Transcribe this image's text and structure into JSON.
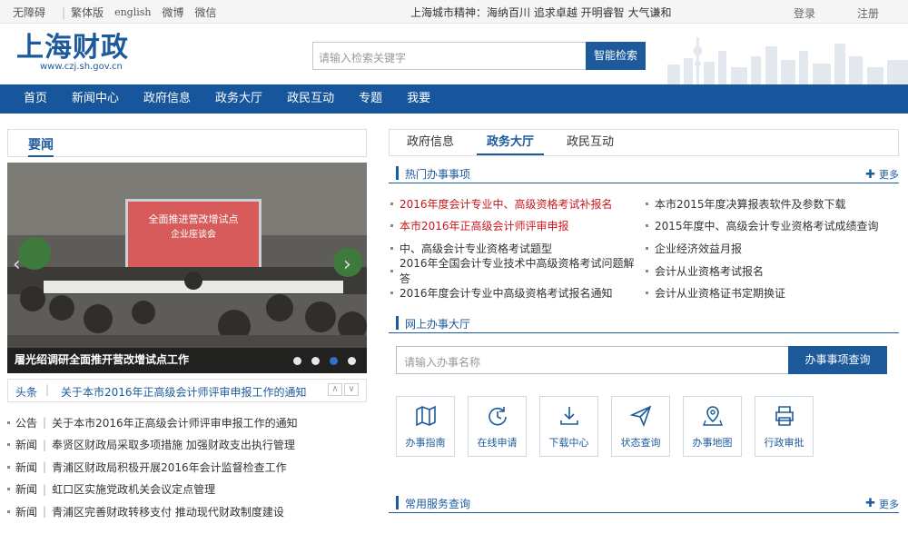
{
  "topbar": {
    "links": [
      "无障碍",
      "繁体版",
      "english",
      "微博",
      "微信"
    ],
    "spirit": "上海城市精神：海纳百川  追求卓越  开明睿智  大气谦和",
    "login": "登录",
    "register": "注册"
  },
  "header": {
    "logo_text": "上海财政",
    "logo_url": "www.czj.sh.gov.cn",
    "search_placeholder": "请输入检索关键字",
    "search_button": "智能检索"
  },
  "nav": [
    "首页",
    "新闻中心",
    "政府信息",
    "政务大厅",
    "政民互动",
    "专题",
    "我要"
  ],
  "left": {
    "tab": "要闻",
    "slide": {
      "banner_line1": "全面推进营改增试点",
      "banner_line2": "企业座谈会",
      "caption": "屠光绍调研全面推开营改增试点工作",
      "dots": 4,
      "active_dot": 3
    },
    "headline": {
      "tag": "头条",
      "text": "关于本市2016年正高级会计师评审申报工作的通知"
    },
    "news": [
      {
        "cat": "公告",
        "title": "关于本市2016年正高级会计师评审申报工作的通知"
      },
      {
        "cat": "新闻",
        "title": "奉贤区财政局采取多项措施 加强财政支出执行管理"
      },
      {
        "cat": "新闻",
        "title": "青浦区财政局积极开展2016年会计监督检查工作"
      },
      {
        "cat": "新闻",
        "title": "虹口区实施党政机关会议定点管理"
      },
      {
        "cat": "新闻",
        "title": "青浦区完善财政转移支付 推动现代财政制度建设"
      }
    ]
  },
  "right": {
    "tabs": [
      "政府信息",
      "政务大厅",
      "政民互动"
    ],
    "active_tab": 1,
    "hot": {
      "title": "热门办事事项",
      "more": "更多",
      "left_items": [
        {
          "text": "2016年度会计专业中、高级资格考试补报名",
          "red": true
        },
        {
          "text": "本市2016年正高级会计师评审申报",
          "red": true
        },
        {
          "text": "中、高级会计专业资格考试题型",
          "red": false
        },
        {
          "text": "2016年全国会计专业技术中高级资格考试问题解答",
          "red": false
        },
        {
          "text": "2016年度会计专业中高级资格考试报名通知",
          "red": false
        }
      ],
      "right_items": [
        "本市2015年度决算报表软件及参数下载",
        "2015年度中、高级会计专业资格考试成绩查询",
        "企业经济效益月报",
        "会计从业资格考试报名",
        "会计从业资格证书定期换证"
      ]
    },
    "online": {
      "title": "网上办事大厅",
      "placeholder": "请输入办事名称",
      "button": "办事事项查询",
      "tiles": [
        {
          "label": "办事指南",
          "icon": "map-icon"
        },
        {
          "label": "在线申请",
          "icon": "refresh-icon"
        },
        {
          "label": "下载中心",
          "icon": "download-icon"
        },
        {
          "label": "状态查询",
          "icon": "send-icon"
        },
        {
          "label": "办事地图",
          "icon": "location-icon"
        },
        {
          "label": "行政审批",
          "icon": "printer-icon"
        }
      ]
    },
    "service": {
      "title": "常用服务查询",
      "more": "更多"
    }
  }
}
